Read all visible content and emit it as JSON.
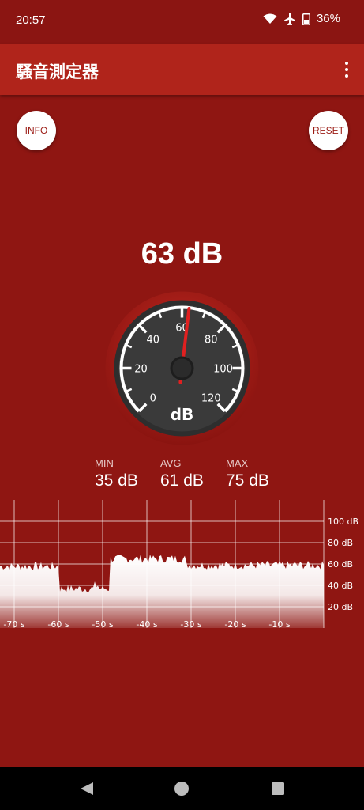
{
  "status_bar": {
    "time": "20:57",
    "battery": "36%"
  },
  "app_bar": {
    "title": "騒音測定器"
  },
  "buttons": {
    "info": "INFO",
    "reset": "RESET"
  },
  "current_reading": "63 dB",
  "gauge": {
    "value": 63,
    "unit": "dB",
    "ticks": [
      "0",
      "20",
      "40",
      "60",
      "80",
      "100",
      "120"
    ],
    "range": [
      0,
      120
    ]
  },
  "stats": {
    "min_label": "MIN",
    "min_value": "35 dB",
    "avg_label": "AVG",
    "avg_value": "61 dB",
    "max_label": "MAX",
    "max_value": "75 dB"
  },
  "graph": {
    "x_labels": [
      "-70 s",
      "-60 s",
      "-50 s",
      "-40 s",
      "-30 s",
      "-20 s",
      "-10 s"
    ],
    "y_labels": [
      "100 dB",
      "80 dB",
      "60 dB",
      "40 dB",
      "20 dB"
    ]
  },
  "colors": {
    "background": "#8f1612",
    "app_bar": "#b0241b",
    "needle": "#e02020"
  }
}
